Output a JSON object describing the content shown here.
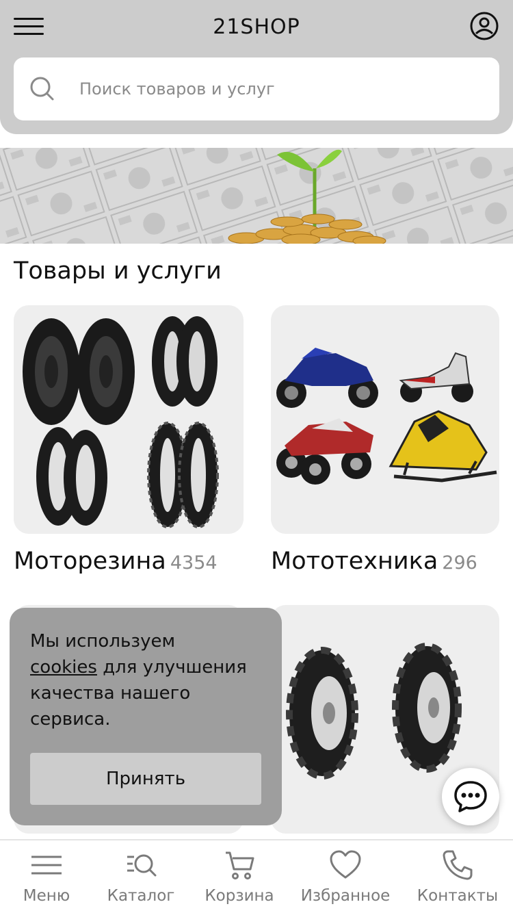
{
  "header": {
    "brand": "21SHOP",
    "search_placeholder": "Поиск товаров и услуг",
    "icons": {
      "menu": "hamburger-icon",
      "profile": "user-circle-icon",
      "search": "search-icon"
    }
  },
  "section": {
    "title": "Товары и услуги"
  },
  "categories": [
    {
      "name": "Моторезина",
      "count": "4354",
      "image": "motorcycle tires"
    },
    {
      "name": "Мототехника",
      "count": "296",
      "image": "motorcycles, scooter, atv, snowmobile"
    },
    {
      "name": "",
      "count": "",
      "image": ""
    },
    {
      "name": "",
      "count": "",
      "image": "tractor tires"
    }
  ],
  "cookie": {
    "text_before": "Мы используем",
    "link": "cookies",
    "text_after": "для улучшения качества нашего сервиса.",
    "accept": "Принять"
  },
  "tabbar": [
    {
      "label": "Меню",
      "icon": "menu-icon"
    },
    {
      "label": "Каталог",
      "icon": "catalog-search-icon"
    },
    {
      "label": "Корзина",
      "icon": "cart-icon"
    },
    {
      "label": "Избранное",
      "icon": "heart-icon"
    },
    {
      "label": "Контакты",
      "icon": "phone-icon"
    }
  ],
  "colors": {
    "header_bg": "#cccccc",
    "cookie_bg": "#9e9e9e",
    "tab_icon": "#7a7a7a"
  }
}
